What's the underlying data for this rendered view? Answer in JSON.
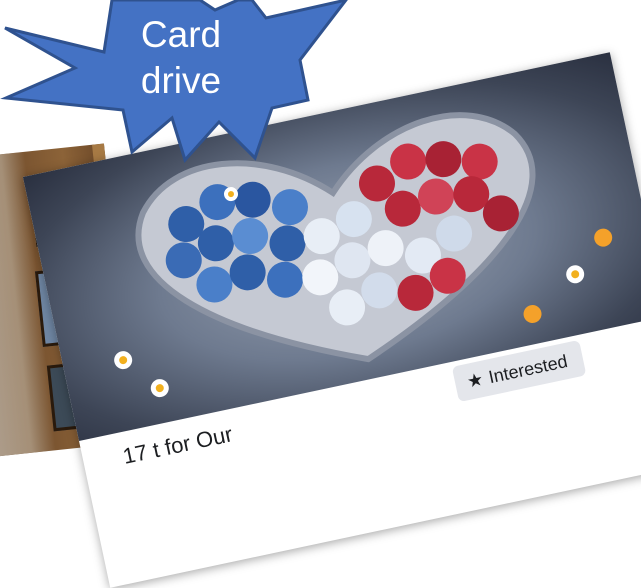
{
  "callout": {
    "line1": "Card",
    "line2": "drive"
  },
  "event": {
    "caption": "17          t for Our",
    "interested_label": "Interested"
  },
  "icons": {
    "interested": "star-icon"
  },
  "colors": {
    "callout_fill": "#4472C4",
    "callout_stroke": "#2F528F",
    "button_bg": "#E4E6EB"
  }
}
